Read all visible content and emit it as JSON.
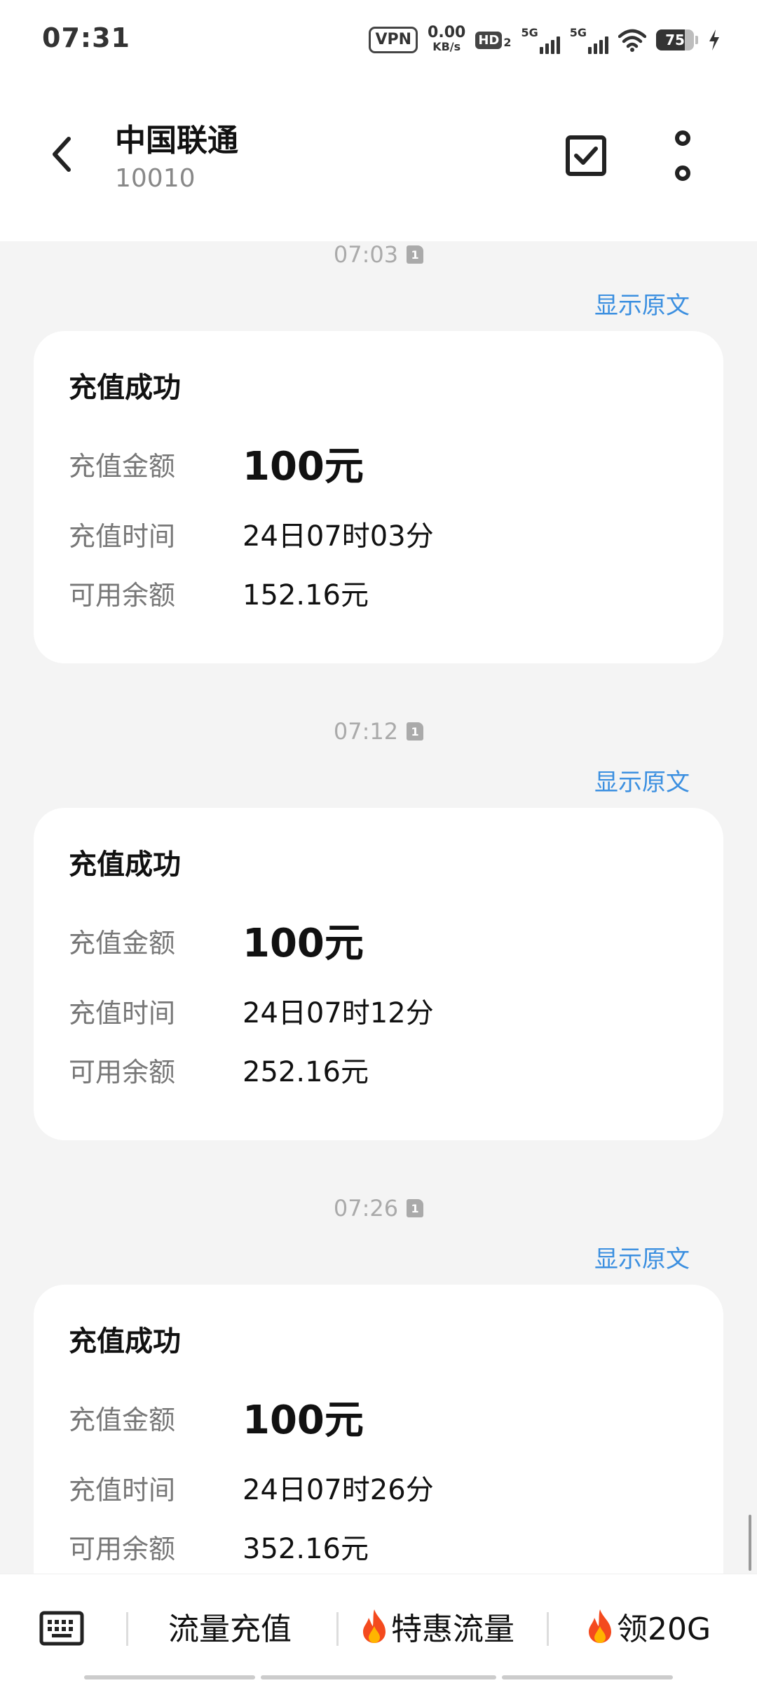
{
  "status_bar": {
    "time": "07:31",
    "vpn": "VPN",
    "speed_value": "0.00",
    "speed_unit": "KB/s",
    "hd": "HD",
    "hd_sub": "2",
    "sim1_label": "5G",
    "sim2_label": "5G",
    "battery": "75"
  },
  "header": {
    "title": "中国联通",
    "number": "10010"
  },
  "messages": [
    {
      "time": "07:03",
      "sim": "1",
      "show_original": "显示原文",
      "card": {
        "title": "充值成功",
        "amount_label": "充值金额",
        "amount_value": "100元",
        "time_label": "充值时间",
        "time_value": "24日07时03分",
        "balance_label": "可用余额",
        "balance_value": "152.16元"
      }
    },
    {
      "time": "07:12",
      "sim": "1",
      "show_original": "显示原文",
      "card": {
        "title": "充值成功",
        "amount_label": "充值金额",
        "amount_value": "100元",
        "time_label": "充值时间",
        "time_value": "24日07时12分",
        "balance_label": "可用余额",
        "balance_value": "252.16元"
      }
    },
    {
      "time": "07:26",
      "sim": "1",
      "show_original": "显示原文",
      "card": {
        "title": "充值成功",
        "amount_label": "充值金额",
        "amount_value": "100元",
        "time_label": "充值时间",
        "time_value": "24日07时26分",
        "balance_label": "可用余额",
        "balance_value": "352.16元"
      }
    }
  ],
  "bottom_bar": {
    "quick1": "流量充值",
    "quick2": "特惠流量",
    "quick3": "领20G"
  },
  "colors": {
    "accent": "#3b8fe0",
    "background": "#f4f4f4",
    "card": "#ffffff"
  }
}
